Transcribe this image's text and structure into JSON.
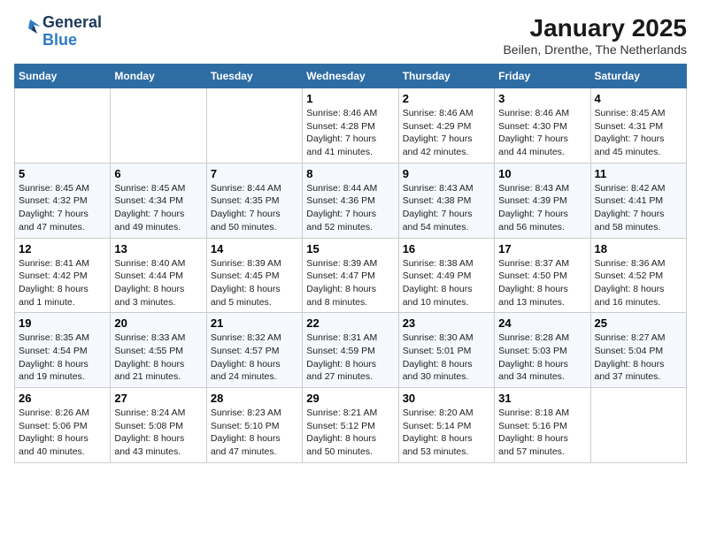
{
  "header": {
    "logo_line1": "General",
    "logo_line2": "Blue",
    "title": "January 2025",
    "subtitle": "Beilen, Drenthe, The Netherlands"
  },
  "days_of_week": [
    "Sunday",
    "Monday",
    "Tuesday",
    "Wednesday",
    "Thursday",
    "Friday",
    "Saturday"
  ],
  "weeks": [
    [
      {
        "day": "",
        "content": ""
      },
      {
        "day": "",
        "content": ""
      },
      {
        "day": "",
        "content": ""
      },
      {
        "day": "1",
        "content": "Sunrise: 8:46 AM\nSunset: 4:28 PM\nDaylight: 7 hours\nand 41 minutes."
      },
      {
        "day": "2",
        "content": "Sunrise: 8:46 AM\nSunset: 4:29 PM\nDaylight: 7 hours\nand 42 minutes."
      },
      {
        "day": "3",
        "content": "Sunrise: 8:46 AM\nSunset: 4:30 PM\nDaylight: 7 hours\nand 44 minutes."
      },
      {
        "day": "4",
        "content": "Sunrise: 8:45 AM\nSunset: 4:31 PM\nDaylight: 7 hours\nand 45 minutes."
      }
    ],
    [
      {
        "day": "5",
        "content": "Sunrise: 8:45 AM\nSunset: 4:32 PM\nDaylight: 7 hours\nand 47 minutes."
      },
      {
        "day": "6",
        "content": "Sunrise: 8:45 AM\nSunset: 4:34 PM\nDaylight: 7 hours\nand 49 minutes."
      },
      {
        "day": "7",
        "content": "Sunrise: 8:44 AM\nSunset: 4:35 PM\nDaylight: 7 hours\nand 50 minutes."
      },
      {
        "day": "8",
        "content": "Sunrise: 8:44 AM\nSunset: 4:36 PM\nDaylight: 7 hours\nand 52 minutes."
      },
      {
        "day": "9",
        "content": "Sunrise: 8:43 AM\nSunset: 4:38 PM\nDaylight: 7 hours\nand 54 minutes."
      },
      {
        "day": "10",
        "content": "Sunrise: 8:43 AM\nSunset: 4:39 PM\nDaylight: 7 hours\nand 56 minutes."
      },
      {
        "day": "11",
        "content": "Sunrise: 8:42 AM\nSunset: 4:41 PM\nDaylight: 7 hours\nand 58 minutes."
      }
    ],
    [
      {
        "day": "12",
        "content": "Sunrise: 8:41 AM\nSunset: 4:42 PM\nDaylight: 8 hours\nand 1 minute."
      },
      {
        "day": "13",
        "content": "Sunrise: 8:40 AM\nSunset: 4:44 PM\nDaylight: 8 hours\nand 3 minutes."
      },
      {
        "day": "14",
        "content": "Sunrise: 8:39 AM\nSunset: 4:45 PM\nDaylight: 8 hours\nand 5 minutes."
      },
      {
        "day": "15",
        "content": "Sunrise: 8:39 AM\nSunset: 4:47 PM\nDaylight: 8 hours\nand 8 minutes."
      },
      {
        "day": "16",
        "content": "Sunrise: 8:38 AM\nSunset: 4:49 PM\nDaylight: 8 hours\nand 10 minutes."
      },
      {
        "day": "17",
        "content": "Sunrise: 8:37 AM\nSunset: 4:50 PM\nDaylight: 8 hours\nand 13 minutes."
      },
      {
        "day": "18",
        "content": "Sunrise: 8:36 AM\nSunset: 4:52 PM\nDaylight: 8 hours\nand 16 minutes."
      }
    ],
    [
      {
        "day": "19",
        "content": "Sunrise: 8:35 AM\nSunset: 4:54 PM\nDaylight: 8 hours\nand 19 minutes."
      },
      {
        "day": "20",
        "content": "Sunrise: 8:33 AM\nSunset: 4:55 PM\nDaylight: 8 hours\nand 21 minutes."
      },
      {
        "day": "21",
        "content": "Sunrise: 8:32 AM\nSunset: 4:57 PM\nDaylight: 8 hours\nand 24 minutes."
      },
      {
        "day": "22",
        "content": "Sunrise: 8:31 AM\nSunset: 4:59 PM\nDaylight: 8 hours\nand 27 minutes."
      },
      {
        "day": "23",
        "content": "Sunrise: 8:30 AM\nSunset: 5:01 PM\nDaylight: 8 hours\nand 30 minutes."
      },
      {
        "day": "24",
        "content": "Sunrise: 8:28 AM\nSunset: 5:03 PM\nDaylight: 8 hours\nand 34 minutes."
      },
      {
        "day": "25",
        "content": "Sunrise: 8:27 AM\nSunset: 5:04 PM\nDaylight: 8 hours\nand 37 minutes."
      }
    ],
    [
      {
        "day": "26",
        "content": "Sunrise: 8:26 AM\nSunset: 5:06 PM\nDaylight: 8 hours\nand 40 minutes."
      },
      {
        "day": "27",
        "content": "Sunrise: 8:24 AM\nSunset: 5:08 PM\nDaylight: 8 hours\nand 43 minutes."
      },
      {
        "day": "28",
        "content": "Sunrise: 8:23 AM\nSunset: 5:10 PM\nDaylight: 8 hours\nand 47 minutes."
      },
      {
        "day": "29",
        "content": "Sunrise: 8:21 AM\nSunset: 5:12 PM\nDaylight: 8 hours\nand 50 minutes."
      },
      {
        "day": "30",
        "content": "Sunrise: 8:20 AM\nSunset: 5:14 PM\nDaylight: 8 hours\nand 53 minutes."
      },
      {
        "day": "31",
        "content": "Sunrise: 8:18 AM\nSunset: 5:16 PM\nDaylight: 8 hours\nand 57 minutes."
      },
      {
        "day": "",
        "content": ""
      }
    ]
  ]
}
